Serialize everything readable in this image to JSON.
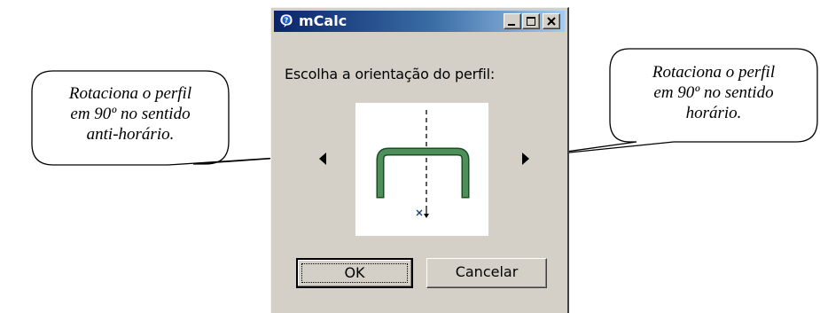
{
  "window": {
    "title": "mCalc",
    "controls": {
      "minimize": "minimize-icon",
      "maximize": "maximize-icon",
      "close": "close-icon"
    }
  },
  "dialog": {
    "prompt": "Escolha a orientação do perfil:",
    "left_arrow_icon": "triangle-left-icon",
    "right_arrow_icon": "triangle-right-icon",
    "preview_icon": "channel-profile-icon",
    "ok_label": "OK",
    "cancel_label": "Cancelar"
  },
  "callouts": {
    "left": [
      "Rotaciona o perfil",
      "em 90º no sentido",
      "anti-horário."
    ],
    "right": [
      "Rotaciona o perfil",
      "em 90º no sentido",
      "horário."
    ]
  },
  "colors": {
    "titlebar_start": "#0a246a",
    "titlebar_end": "#a6caf0",
    "dialog_face": "#d4d0c8",
    "profile_green": "#4f8f5a"
  }
}
